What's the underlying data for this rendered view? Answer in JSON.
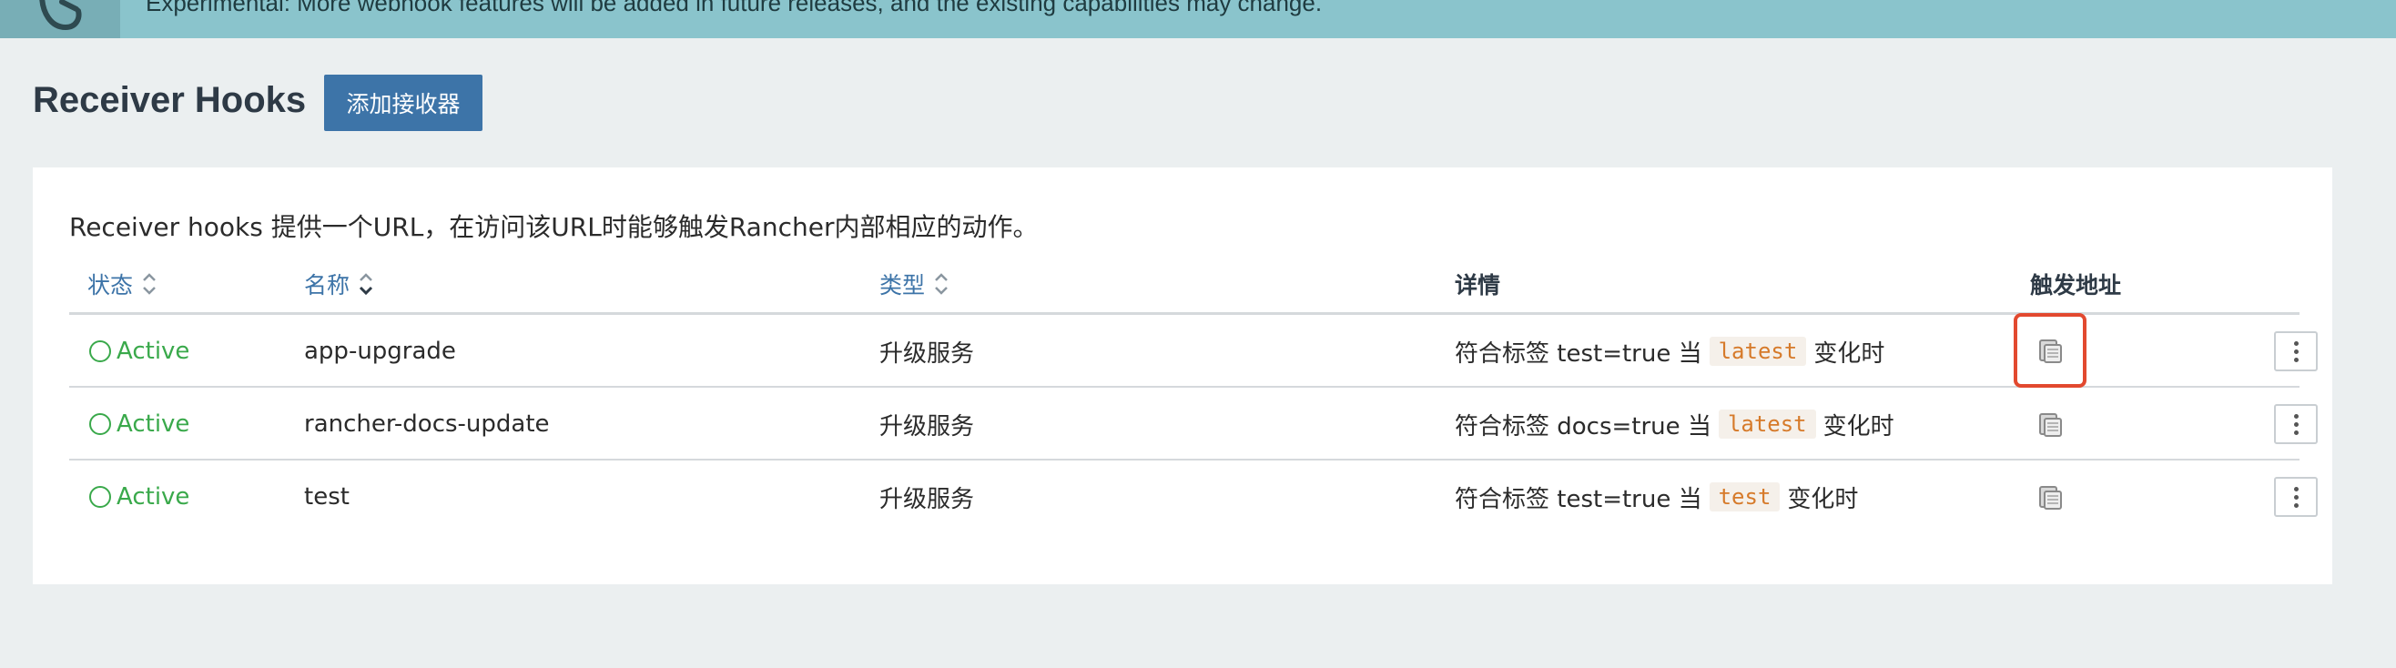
{
  "banner": {
    "text": "Experimental: More webhook features will be added in future releases, and the existing capabilities may change."
  },
  "header": {
    "title": "Receiver Hooks",
    "add_button": "添加接收器"
  },
  "panel": {
    "description": "Receiver hooks 提供一个URL，在访问该URL时能够触发Rancher内部相应的动作。"
  },
  "table": {
    "columns": {
      "status": "状态",
      "name": "名称",
      "type": "类型",
      "details": "详情",
      "trigger_url": "触发地址"
    },
    "rows": [
      {
        "status": "Active",
        "name": "app-upgrade",
        "type": "升级服务",
        "detail_prefix": "符合标签 test=true 当",
        "detail_tag": "latest",
        "detail_suffix": "变化时"
      },
      {
        "status": "Active",
        "name": "rancher-docs-update",
        "type": "升级服务",
        "detail_prefix": "符合标签 docs=true 当",
        "detail_tag": "latest",
        "detail_suffix": "变化时"
      },
      {
        "status": "Active",
        "name": "test",
        "type": "升级服务",
        "detail_prefix": "符合标签 test=true 当",
        "detail_tag": "test",
        "detail_suffix": "变化时"
      }
    ]
  },
  "icons": {
    "banner": "rancher-logo-icon",
    "sort": "sort-icon",
    "copy": "copy-icon",
    "menu": "more-vertical-icon"
  },
  "colors": {
    "accent": "#3d74a8",
    "active": "#3aa94b",
    "highlight": "#e2492f",
    "banner": "#8ac4cc"
  }
}
